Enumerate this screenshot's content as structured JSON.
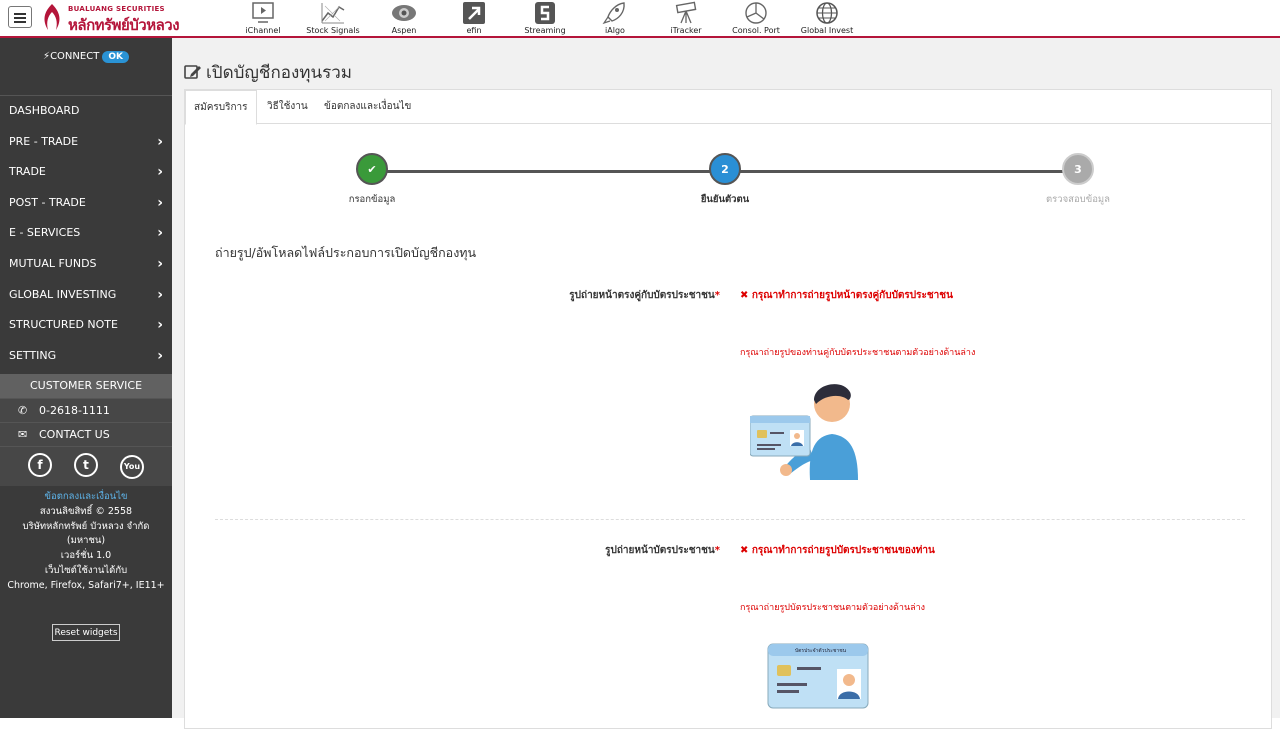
{
  "header": {
    "logo_sub": "BUALUANG SECURITIES",
    "logo_main": "หลักทรัพย์บัวหลวง",
    "brand_color": "#b4153a",
    "apps": [
      {
        "label": "iChannel",
        "icon": "play-screen-icon"
      },
      {
        "label": "Stock Signals",
        "icon": "chart-signal-icon"
      },
      {
        "label": "Aspen",
        "icon": "aspen-eye-icon"
      },
      {
        "label": "efin",
        "icon": "efin-arrow-icon"
      },
      {
        "label": "Streaming",
        "icon": "streaming-s-icon"
      },
      {
        "label": "iAlgo",
        "icon": "rocket-icon"
      },
      {
        "label": "iTracker",
        "icon": "telescope-icon"
      },
      {
        "label": "Consol. Port",
        "icon": "pie-chart-icon"
      },
      {
        "label": "Global Invest",
        "icon": "globe-icon"
      }
    ]
  },
  "sidebar": {
    "connect_label": "CONNECT",
    "connect_status": "OK",
    "items": [
      {
        "label": "DASHBOARD",
        "has_chevron": false
      },
      {
        "label": "PRE - TRADE",
        "has_chevron": true
      },
      {
        "label": "TRADE",
        "has_chevron": true
      },
      {
        "label": "POST - TRADE",
        "has_chevron": true
      },
      {
        "label": "E - SERVICES",
        "has_chevron": true
      },
      {
        "label": "MUTUAL FUNDS",
        "has_chevron": true
      },
      {
        "label": "GLOBAL INVESTING",
        "has_chevron": true
      },
      {
        "label": "STRUCTURED NOTE",
        "has_chevron": true
      },
      {
        "label": "SETTING",
        "has_chevron": true
      }
    ],
    "customer_service": {
      "heading": "CUSTOMER SERVICE",
      "phone": "0-2618-1111",
      "contact": "CONTACT US"
    },
    "footer": {
      "terms": "ข้อตกลงและเงื่อนไข",
      "copyright": "สงวนลิขสิทธิ์ © 2558",
      "company": "บริษัทหลักทรัพย์ บัวหลวง จำกัด",
      "company_suffix": "(มหาชน)",
      "version": "เวอร์ชั่น 1.0",
      "browser_label": "เว็บไซต์ใช้งานได้กับ",
      "browsers": "Chrome, Firefox, Safari7+, IE11+",
      "reset_label": "Reset widgets"
    }
  },
  "main": {
    "title": "เปิดบัญชีกองทุนรวม",
    "tabs": [
      "สมัครบริการ",
      "วิธีใช้งาน",
      "ข้อตกลงและเงื่อนไข"
    ],
    "steps": [
      {
        "num": "✔",
        "label": "กรอกข้อมูล",
        "state": "done",
        "color": "#3a9a3a"
      },
      {
        "num": "2",
        "label": "ยืนยันตัวตน",
        "state": "active",
        "color": "#2a8fd5"
      },
      {
        "num": "3",
        "label": "ตรวจสอบข้อมูล",
        "state": "pending",
        "color": "#aaaaaa"
      }
    ],
    "section_title": "ถ่ายรูป/อัพโหลดไฟล์ประกอบการเปิดบัญชีกองทุน",
    "fields": [
      {
        "label": "รูปถ่ายหน้าตรงคู่กับบัตรประชาชน",
        "required": "*",
        "error": "กรุณาทำการถ่ายรูปหน้าตรงคู่กับบัตรประชาชน",
        "hint": "กรุณาถ่ายรูปของท่านคู่กับบัตรประชาชนตามตัวอย่างด้านล่าง"
      },
      {
        "label": "รูปถ่ายหน้าบัตรประชาชน",
        "required": "*",
        "error": "กรุณาทำการถ่ายรูปบัตรประชาชนของท่าน",
        "hint": "กรุณาถ่ายรูปบัตรประชาชนตามตัวอย่างด้านล่าง"
      }
    ],
    "id_card_header": "บัตรประจำตัวประชาชน"
  }
}
